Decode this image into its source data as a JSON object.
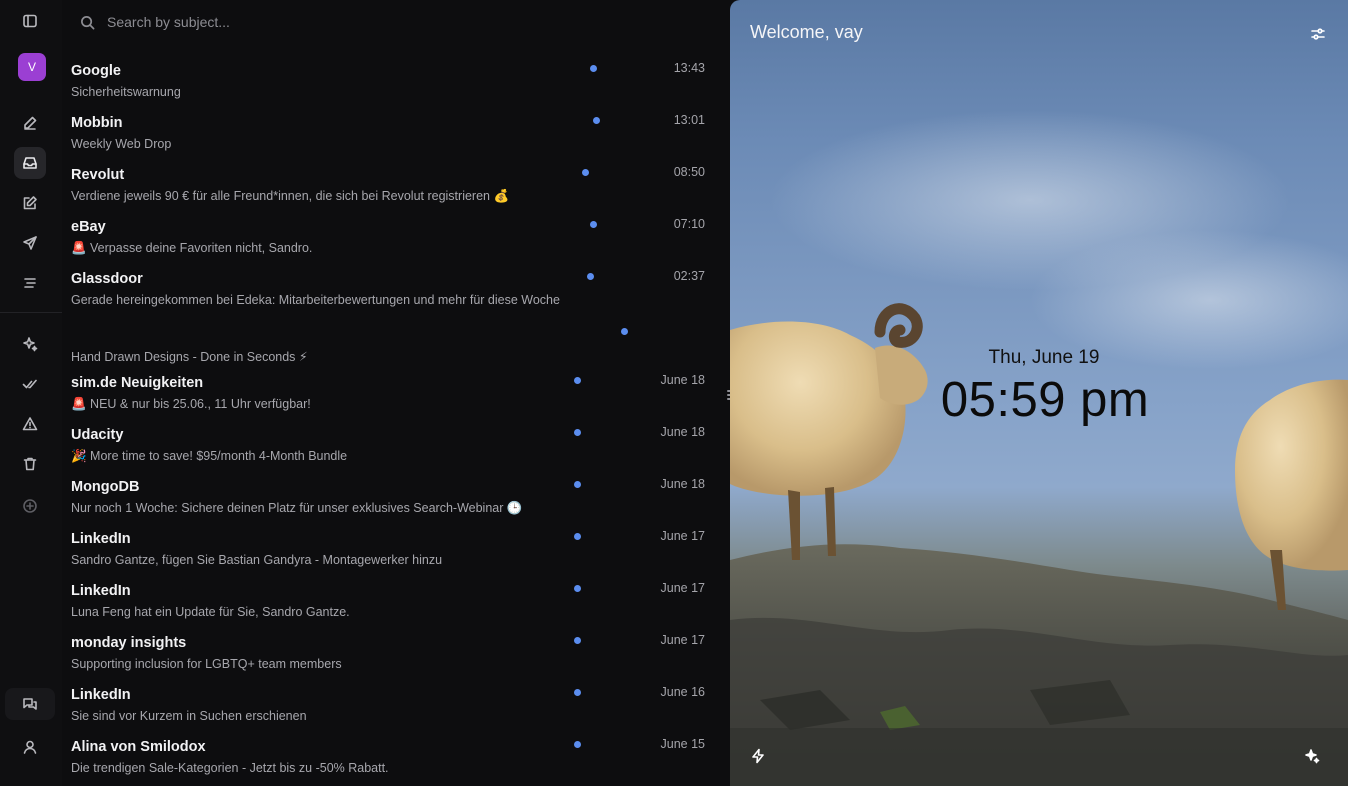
{
  "search": {
    "placeholder": "Search by subject..."
  },
  "user": {
    "avatar_letter": "V"
  },
  "rail": {
    "icons": [
      "sidebar-toggle-icon",
      "pen-icon",
      "inbox-icon",
      "compose-icon",
      "send-icon",
      "list-icon",
      "sparkles-icon",
      "double-check-icon",
      "alert-icon",
      "trash-icon",
      "plus-circle-icon",
      "chat-icon",
      "user-icon"
    ]
  },
  "mails": [
    {
      "sender": "Google",
      "subject": "Sicherheitswarnung",
      "time": "13:43"
    },
    {
      "sender": "Mobbin",
      "subject": "Weekly Web Drop",
      "time": "13:01"
    },
    {
      "sender": "Revolut",
      "subject": "Verdiene jeweils 90 € für alle Freund*innen, die sich bei Revolut registrieren 💰",
      "time": "08:50"
    },
    {
      "sender": "eBay",
      "subject": "🚨 Verpasse deine Favoriten nicht, Sandro.",
      "time": "07:10"
    },
    {
      "sender": "Glassdoor",
      "subject": "Gerade hereingekommen bei Edeka: Mitarbeiterbewertungen und mehr für diese Woche",
      "time": "02:37"
    },
    {
      "sender": "",
      "subject": "Hand Drawn Designs - Done in Seconds ⚡",
      "time": ""
    },
    {
      "sender": "sim.de Neuigkeiten",
      "subject": "🚨 NEU & nur bis 25.06., 11 Uhr verfügbar!",
      "time": "June 18"
    },
    {
      "sender": "Udacity",
      "subject": "🎉 More time to save! $95/month 4-Month Bundle",
      "time": "June 18"
    },
    {
      "sender": "MongoDB",
      "subject": "Nur noch 1 Woche: Sichere deinen Platz für unser exklusives Search-Webinar 🕒",
      "time": "June 18"
    },
    {
      "sender": "LinkedIn",
      "subject": "Sandro Gantze, fügen Sie Bastian Gandyra - Montagewerker hinzu",
      "time": "June 17"
    },
    {
      "sender": "LinkedIn",
      "subject": "Luna Feng hat ein Update für Sie, Sandro Gantze.",
      "time": "June 17"
    },
    {
      "sender": "monday insights",
      "subject": "Supporting inclusion for LGBTQ+ team members",
      "time": "June 17"
    },
    {
      "sender": "LinkedIn",
      "subject": "Sie sind vor Kurzem in Suchen erschienen",
      "time": "June 16"
    },
    {
      "sender": "Alina von Smilodox",
      "subject": "Die trendigen Sale-Kategorien - Jetzt bis zu -50% Rabatt.",
      "time": "June 15"
    }
  ],
  "hero": {
    "welcome": "Welcome, vay",
    "date": "Thu, June 19",
    "time": "05:59 pm"
  },
  "colors": {
    "accent_dot": "#5b8def",
    "avatar": "#9b3fd3",
    "background": "#0d0d0f"
  }
}
